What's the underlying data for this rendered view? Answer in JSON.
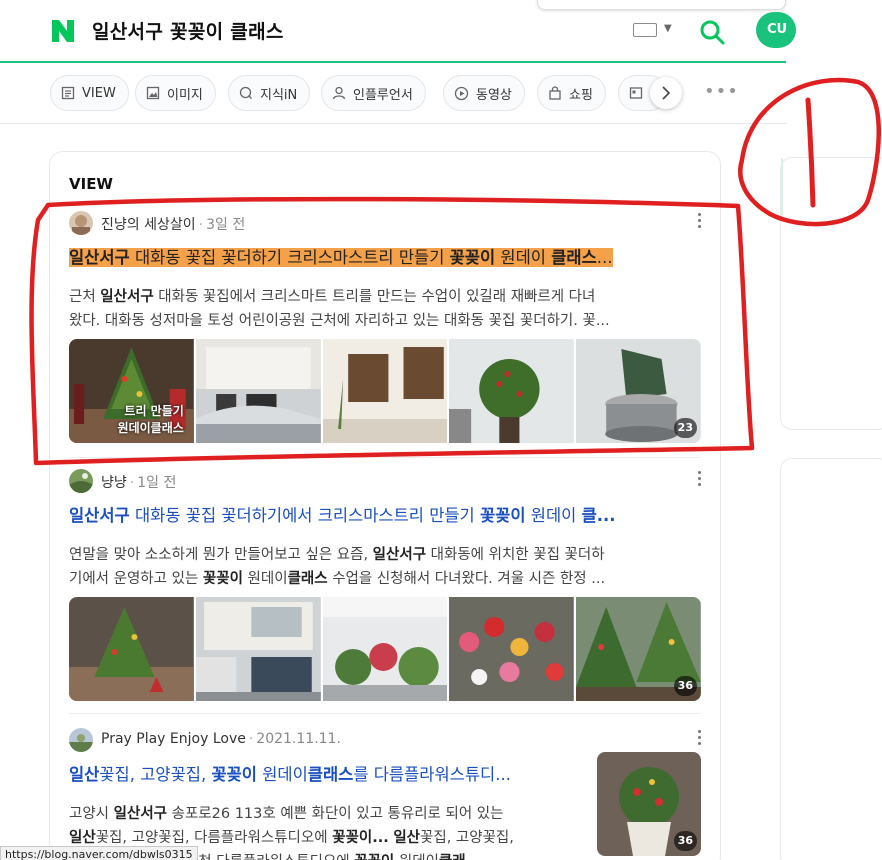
{
  "search": {
    "query": "일산서구 꽃꽂이 클래스",
    "profile_label": "CU"
  },
  "tabs": [
    {
      "label": "VIEW",
      "icon": "document-icon"
    },
    {
      "label": "이미지",
      "icon": "image-icon"
    },
    {
      "label": "지식iN",
      "icon": "qa-icon"
    },
    {
      "label": "인플루언서",
      "icon": "person-icon"
    },
    {
      "label": "동영상",
      "icon": "play-icon"
    },
    {
      "label": "쇼핑",
      "icon": "bag-icon"
    },
    {
      "label": "",
      "icon": "news-icon"
    }
  ],
  "section": {
    "title": "VIEW"
  },
  "posts": [
    {
      "author": "진냥의 세상살이",
      "date": "3일 전",
      "title_parts": [
        {
          "text": "일산서구",
          "bold": true
        },
        {
          "text": " 대화동 꽃집 꽃더하기 크리스마스트리 만들기 ",
          "bold": false
        },
        {
          "text": "꽃꽂이",
          "bold": true
        },
        {
          "text": " 원데이 ",
          "bold": false
        },
        {
          "text": "클래스",
          "bold": true
        },
        {
          "text": "...",
          "bold": false
        }
      ],
      "snippet_line1_parts": [
        {
          "text": "근처 ",
          "bold": false
        },
        {
          "text": "일산서구",
          "bold": true
        },
        {
          "text": " 대화동 꽃집에서 크리스마트 트리를 만드는 수업이 있길래 재빠르게 다녀",
          "bold": false
        }
      ],
      "snippet_line2": "왔다. 대화동 성저마을 토성 어린이공원 근처에 자리하고 있는 대화동 꽃집 꽃더하기. 꽃...",
      "thumb_overlay_1": "트리 만들기",
      "thumb_overlay_2": "원데이클래스",
      "image_count": "23",
      "highlighted": true
    },
    {
      "author": "냥냥",
      "date": "1일 전",
      "title_parts": [
        {
          "text": "일산서구",
          "bold": true
        },
        {
          "text": " 대화동 꽃집 꽃더하기에서 크리스마스트리 만들기 ",
          "bold": false
        },
        {
          "text": "꽃꽂이",
          "bold": true
        },
        {
          "text": " 원데이 ",
          "bold": false
        },
        {
          "text": "클...",
          "bold": true
        }
      ],
      "snippet_line1_parts": [
        {
          "text": "연말을 맞아 소소하게 뭔가 만들어보고 싶은 요즘, ",
          "bold": false
        },
        {
          "text": "일산서구",
          "bold": true
        },
        {
          "text": " 대화동에 위치한 꽃집 꽃더하",
          "bold": false
        }
      ],
      "snippet_line2_parts": [
        {
          "text": "기에서 운영하고 있는 ",
          "bold": false
        },
        {
          "text": "꽃꽂이",
          "bold": true
        },
        {
          "text": " 원데이",
          "bold": false
        },
        {
          "text": "클래스",
          "bold": true
        },
        {
          "text": " 수업을 신청해서 다녀왔다. 겨울 시즌 한정 ...",
          "bold": false
        }
      ],
      "image_count": "36"
    },
    {
      "author": "Pray Play Enjoy Love",
      "date": "2021.11.11.",
      "title_parts": [
        {
          "text": "일산",
          "bold": true
        },
        {
          "text": "꽃집, 고양꽃집, ",
          "bold": false
        },
        {
          "text": "꽃꽂이",
          "bold": true
        },
        {
          "text": " 원데이",
          "bold": false
        },
        {
          "text": "클래스",
          "bold": true
        },
        {
          "text": "를 다름플라워스튜디...",
          "bold": false
        }
      ],
      "snippet_line1_parts": [
        {
          "text": "고양시 ",
          "bold": false
        },
        {
          "text": "일산서구",
          "bold": true
        },
        {
          "text": " 송포로26 113호 예쁜 화단이 있고 통유리로 되어 있는",
          "bold": false
        }
      ],
      "snippet_line2_parts": [
        {
          "text": "일산",
          "bold": true
        },
        {
          "text": "꽃집, 고양꽃집, 다름플라워스튜디오에 ",
          "bold": false
        },
        {
          "text": "꽃꽂이...",
          "bold": true
        },
        {
          "text": " ",
          "bold": false
        },
        {
          "text": "일산",
          "bold": true
        },
        {
          "text": "꽃집, 고양꽃집,",
          "bold": false
        }
      ],
      "snippet_line3_parts": [
        {
          "text": "일산꽃집, 고양꽃집추천 다름플라워스튜디오에 ",
          "bold": false
        },
        {
          "text": "꽃꽂이",
          "bold": true
        },
        {
          "text": " 원데이",
          "bold": false
        },
        {
          "text": "클래...",
          "bold": true
        }
      ],
      "image_count": "36"
    }
  ],
  "annotation": {
    "label": "1",
    "color": "#e02020"
  },
  "status_url": "https://blog.naver.com/dbwls0315",
  "colors": {
    "brand": "#03c75a",
    "link": "#1a4fbf",
    "highlight": "#f5a14a"
  }
}
